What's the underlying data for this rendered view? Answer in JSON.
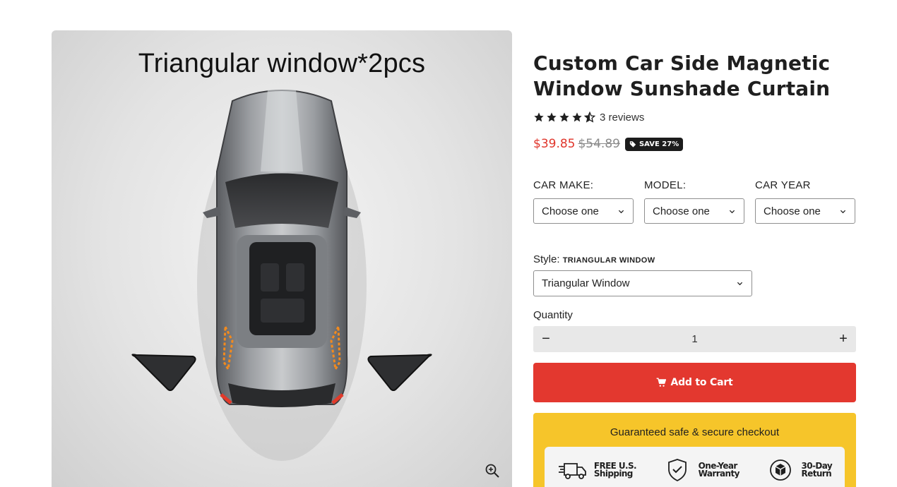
{
  "media": {
    "caption": "Triangular window*2pcs",
    "zoom_icon": "zoom-in-icon"
  },
  "product": {
    "title_line1": "Custom Car Side Magnetic",
    "title_line2": "Window Sunshade Curtain",
    "rating": 4.5,
    "reviews_label": "3 reviews",
    "price": "$39.85",
    "compare_price": "$54.89",
    "save_badge": "SAVE 27%"
  },
  "selectors": {
    "car_make": {
      "label": "CAR MAKE:",
      "value": "Choose one"
    },
    "model": {
      "label": "MODEL:",
      "value": "Choose one"
    },
    "car_year": {
      "label": "CAR YEAR",
      "value": "Choose one"
    }
  },
  "style": {
    "label": "Style:",
    "current": "TRIANGULAR WINDOW",
    "value": "Triangular Window"
  },
  "quantity": {
    "label": "Quantity",
    "value": "1",
    "minus": "−",
    "plus": "+"
  },
  "cart": {
    "label": "Add to Cart",
    "icon": "cart-icon"
  },
  "secure": {
    "title": "Guaranteed safe & secure checkout",
    "badges": [
      {
        "icon": "truck-icon",
        "line1": "FREE U.S.",
        "line2": "Shipping"
      },
      {
        "icon": "shield-check-icon",
        "line1": "One-Year",
        "line2": "Warranty"
      },
      {
        "icon": "box-return-icon",
        "line1": "30-Day",
        "line2": "Return"
      }
    ]
  },
  "colors": {
    "price": "#e0352b",
    "add_to_cart": "#e3382f",
    "secure_bg": "#f6c52a",
    "badge_bg": "#1c1c1c"
  }
}
